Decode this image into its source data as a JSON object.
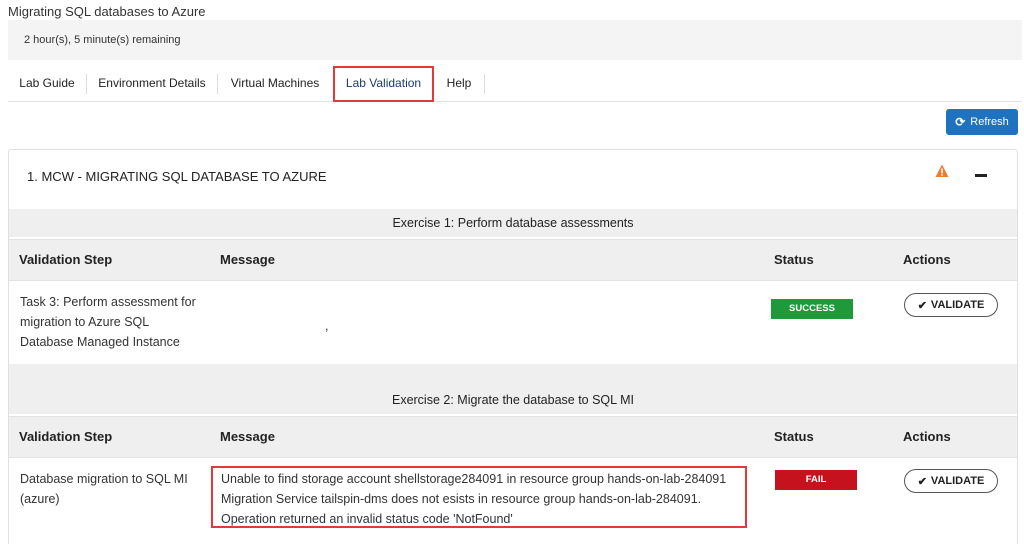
{
  "page": {
    "title": "Migrating SQL databases to Azure",
    "time_remaining": "2 hour(s), 5 minute(s) remaining"
  },
  "tabs": [
    {
      "label": "Lab Guide"
    },
    {
      "label": "Environment Details"
    },
    {
      "label": "Virtual Machines"
    },
    {
      "label": "Lab Validation",
      "active": true
    },
    {
      "label": "Help"
    }
  ],
  "toolbar": {
    "refresh_label": "Refresh"
  },
  "panel": {
    "title": "1. MCW - MIGRATING SQL DATABASE TO AZURE",
    "columns": {
      "step": "Validation Step",
      "message": "Message",
      "status": "Status",
      "actions": "Actions"
    },
    "exercises": [
      {
        "title": "Exercise 1: Perform database assessments",
        "rows": [
          {
            "step": "Task 3: Perform assessment for migration to Azure SQL Database Managed Instance",
            "message": ",",
            "status": "SUCCESS",
            "action": "VALIDATE"
          }
        ]
      },
      {
        "title": "Exercise 2: Migrate the database to SQL MI",
        "rows": [
          {
            "step": "Database migration to SQL MI (azure)",
            "message": "Unable to find storage account shellstorage284091 in resource group hands-on-lab-284091 Migration Service tailspin-dms does not esists in resource group hands-on-lab-284091. Operation returned an invalid status code 'NotFound'",
            "status": "FAIL",
            "action": "VALIDATE"
          }
        ]
      }
    ]
  },
  "colors": {
    "accent": "#1e72c0",
    "success": "#1f9a3a",
    "fail": "#c5121c",
    "highlight": "#e03b3b",
    "warning": "#f07a2e"
  }
}
